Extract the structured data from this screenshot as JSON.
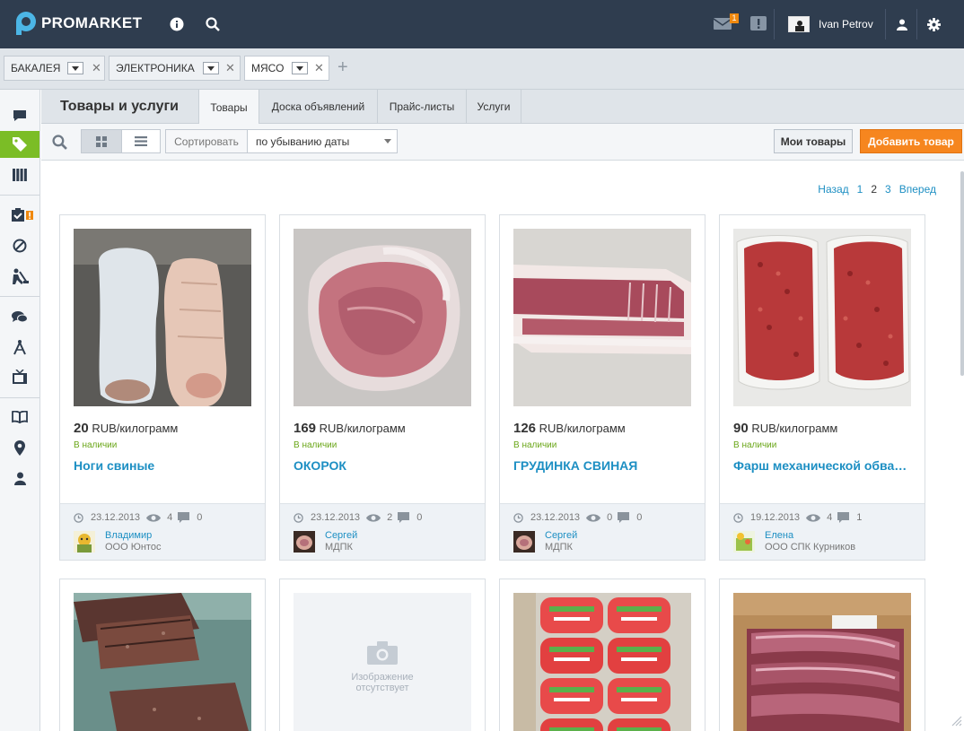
{
  "app": {
    "brand": "PROMARKET"
  },
  "topbar": {
    "user_name": "Ivan Petrov",
    "messages_badge": "1"
  },
  "category_tabs": [
    {
      "label": "БАКАЛЕЯ"
    },
    {
      "label": "ЭЛЕКТРОНИКА"
    },
    {
      "label": "МЯСО"
    }
  ],
  "section": {
    "title": "Товары и услуги",
    "tabs": [
      {
        "label": "Товары"
      },
      {
        "label": "Доска объявлений"
      },
      {
        "label": "Прайс-листы"
      },
      {
        "label": "Услуги"
      }
    ]
  },
  "toolbar": {
    "sort_label": "Сортировать",
    "sort_value": "по убыванию даты",
    "my_products": "Мои товары",
    "add_product": "Добавить товар"
  },
  "pager": {
    "prev": "Назад",
    "pages": [
      "1",
      "2",
      "3"
    ],
    "current": "2",
    "next": "Вперед"
  },
  "products": [
    {
      "price": "20",
      "unit": "RUB/килограмм",
      "stock": "В наличии",
      "name": "Ноги свиные",
      "date": "23.12.2013",
      "views": "4",
      "comments": "0",
      "seller": "Владимир",
      "org": "ООО Юнтос"
    },
    {
      "price": "169",
      "unit": "RUB/килограмм",
      "stock": "В наличии",
      "name": "ОКОРОК",
      "date": "23.12.2013",
      "views": "2",
      "comments": "0",
      "seller": "Сергей",
      "org": "МДПК"
    },
    {
      "price": "126",
      "unit": "RUB/килограмм",
      "stock": "В наличии",
      "name": "ГРУДИНКА СВИНАЯ",
      "date": "23.12.2013",
      "views": "0",
      "comments": "0",
      "seller": "Сергей",
      "org": "МДПК"
    },
    {
      "price": "90",
      "unit": "RUB/килограмм",
      "stock": "В наличии",
      "name": "Фарш механической обвалки",
      "date": "19.12.2013",
      "views": "4",
      "comments": "1",
      "seller": "Елена",
      "org": "ООО СПК Курников"
    }
  ],
  "no_image": {
    "line1": "Изображение",
    "line2": "отсутствует"
  },
  "colors": {
    "topbar": "#2f3d4f",
    "accent_green": "#7bbd26",
    "link_blue": "#1d8fc3",
    "orange": "#f6861f"
  }
}
